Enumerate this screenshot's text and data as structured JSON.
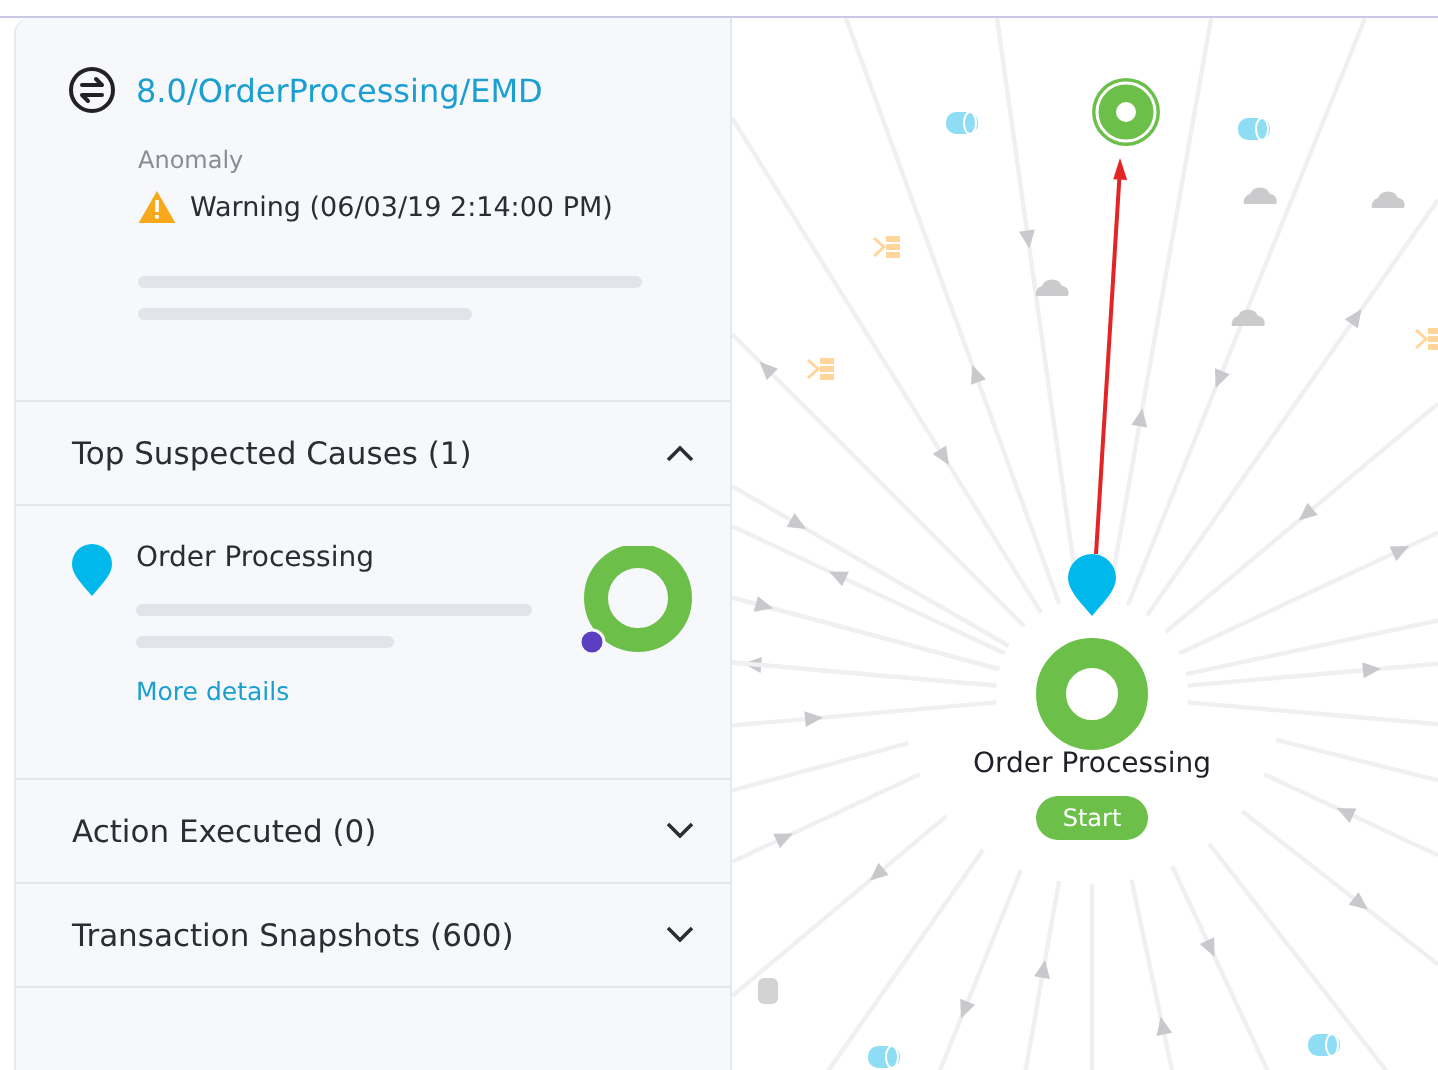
{
  "header": {
    "title": "8.0/OrderProcessing/EMD",
    "label": "Anomaly",
    "warning": "Warning (06/03/19 2:14:00 PM)"
  },
  "sections": [
    {
      "title": "Top Suspected Causes (1)",
      "expanded": true,
      "causes": [
        {
          "name": "Order Processing",
          "link": "More details"
        }
      ]
    },
    {
      "title": "Action Executed (0)",
      "expanded": false
    },
    {
      "title": "Transaction Snapshots (600)",
      "expanded": false
    }
  ],
  "graph": {
    "node": {
      "label": "Order Processing",
      "badge": "Start"
    }
  }
}
